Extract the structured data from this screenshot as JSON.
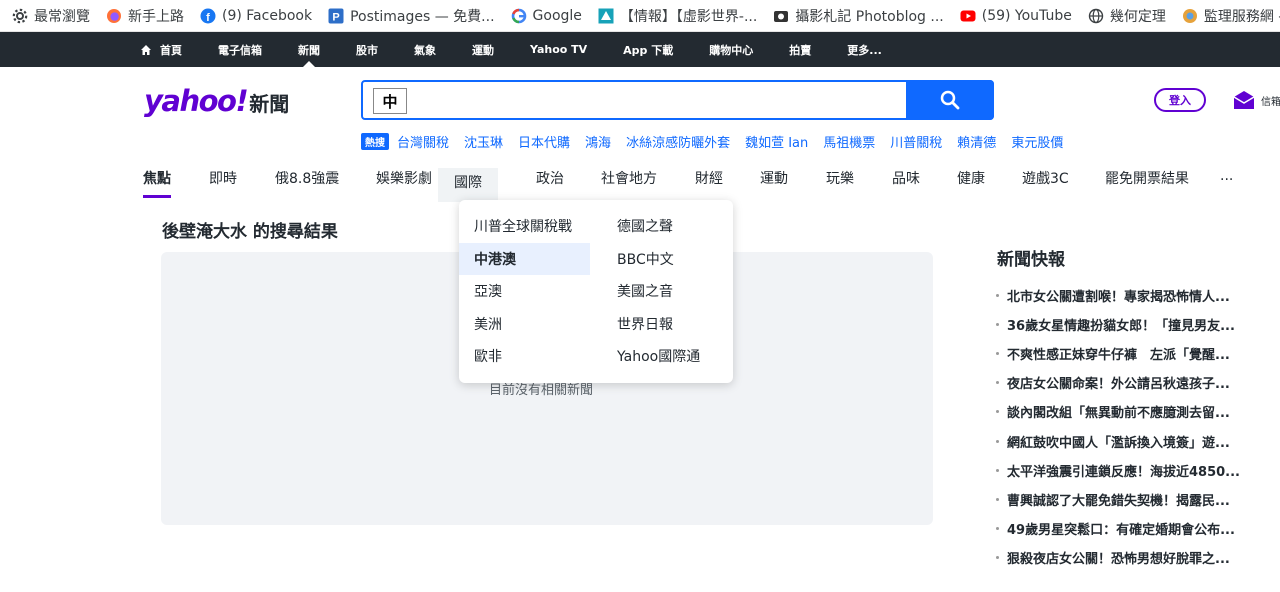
{
  "bookmarks": [
    {
      "label": "最常瀏覽",
      "icon": "gear-icon",
      "color": "#3c4043"
    },
    {
      "label": "新手上路",
      "icon": "firefox-icon",
      "color": "#ff7139"
    },
    {
      "label": "(9) Facebook",
      "icon": "facebook-icon",
      "color": "#1877f2"
    },
    {
      "label": "Postimages — 免費...",
      "icon": "postimages-icon",
      "color": "#2d6ec8"
    },
    {
      "label": "Google",
      "icon": "google-icon",
      "color": "#4285f4"
    },
    {
      "label": "【情報】【虛影世界-...",
      "icon": "bahamut-icon",
      "color": "#17a2b8"
    },
    {
      "label": "攝影札記 Photoblog ...",
      "icon": "photoblog-icon",
      "color": "#333333"
    },
    {
      "label": "(59) YouTube",
      "icon": "youtube-icon",
      "color": "#ff0000"
    },
    {
      "label": "幾何定理",
      "icon": "globe-icon",
      "color": "#3c4043"
    },
    {
      "label": "監理服務網 - 交通部...",
      "icon": "mvdis-icon",
      "color": "#e6a23c"
    }
  ],
  "topnav": [
    {
      "label": "首頁",
      "home": true
    },
    {
      "label": "電子信箱"
    },
    {
      "label": "新聞",
      "active": true
    },
    {
      "label": "股市"
    },
    {
      "label": "氣象"
    },
    {
      "label": "運動"
    },
    {
      "label": "Yahoo TV"
    },
    {
      "label": "App 下載"
    },
    {
      "label": "購物中心"
    },
    {
      "label": "拍賣"
    },
    {
      "label": "更多..."
    }
  ],
  "header": {
    "logo_text": "yahoo!",
    "logo_suffix": "新聞",
    "search_prefix": "中",
    "search_value": "",
    "login_label": "登入",
    "mail_label": "信箱"
  },
  "trending": {
    "badge": "熱搜",
    "items": [
      "台灣關稅",
      "沈玉琳",
      "日本代購",
      "鴻海",
      "冰絲涼感防曬外套",
      "魏如萱 Ian",
      "馬祖機票",
      "川普關稅",
      "賴清德",
      "東元股價"
    ]
  },
  "categories": [
    {
      "label": "焦點",
      "active": true
    },
    {
      "label": "即時"
    },
    {
      "label": "俄8.8強震"
    },
    {
      "label": "娛樂影劇"
    },
    {
      "label": "國際",
      "hover": true
    },
    {
      "label": "政治"
    },
    {
      "label": "社會地方"
    },
    {
      "label": "財經"
    },
    {
      "label": "運動"
    },
    {
      "label": "玩樂"
    },
    {
      "label": "品味"
    },
    {
      "label": "健康"
    },
    {
      "label": "遊戲3C"
    },
    {
      "label": "罷免開票結果"
    },
    {
      "label": "..."
    }
  ],
  "dropdown": {
    "left": [
      "川普全球關稅戰",
      "中港澳",
      "亞澳",
      "美洲",
      "歐非"
    ],
    "right": [
      "德國之聲",
      "BBC中文",
      "美國之音",
      "世界日報",
      "Yahoo國際通"
    ],
    "selected": "中港澳"
  },
  "main": {
    "result_title": "後壁淹大水 的搜尋結果",
    "empty_text": "目前沒有相關新聞"
  },
  "flash": {
    "title": "新聞快報",
    "items": [
      "北市女公關遭割喉！專家揭恐怖情人...",
      "36歲女星情趣扮貓女郎！「撞見男友...",
      "不爽性感正妹穿牛仔褲　左派「覺醒...",
      "夜店女公關命案！外公請呂秋遠孩子...",
      "談內閣改組「無異動前不應臆測去留...",
      "網紅鼓吹中國人「濫訴換入境簽」遊...",
      "太平洋強震引連鎖反應！海拔近4850...",
      "曹興誠認了大罷免錯失契機！揭露民...",
      "49歲男星突鬆口：有確定婚期會公布...",
      "狠殺夜店女公關！恐怖男想好脫罪之..."
    ]
  },
  "colors": {
    "brand": "#6001d2",
    "accent": "#0f69ff",
    "topbar": "#232a31"
  }
}
